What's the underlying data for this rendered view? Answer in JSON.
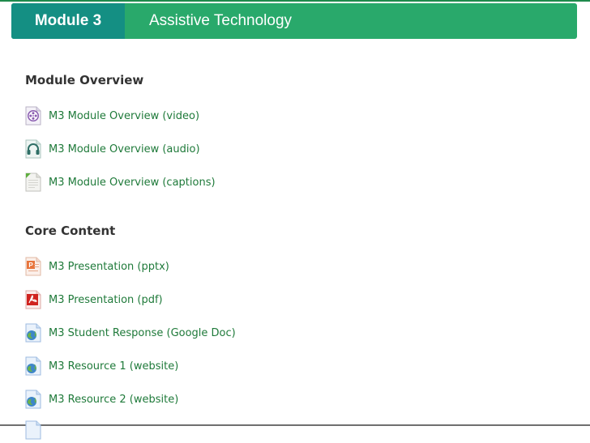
{
  "module": {
    "badge": "Module 3",
    "title": "Assistive Technology"
  },
  "sections": [
    {
      "heading": "Module Overview",
      "items": [
        {
          "label": "M3 Module Overview (video)",
          "icon": "video-file-icon"
        },
        {
          "label": "M3 Module Overview (audio)",
          "icon": "audio-file-icon"
        },
        {
          "label": "M3 Module Overview (captions)",
          "icon": "text-file-icon"
        }
      ]
    },
    {
      "heading": "Core Content",
      "items": [
        {
          "label": "M3 Presentation (pptx)",
          "icon": "powerpoint-file-icon"
        },
        {
          "label": "M3 Presentation (pdf)",
          "icon": "pdf-file-icon"
        },
        {
          "label": "M3 Student Response (Google Doc)",
          "icon": "web-link-icon"
        },
        {
          "label": "M3 Resource 1 (website)",
          "icon": "web-link-icon"
        },
        {
          "label": "M3 Resource 2 (website)",
          "icon": "web-link-icon"
        }
      ]
    }
  ],
  "colors": {
    "header_green": "#29a96b",
    "badge_teal": "#148f83",
    "link_green": "#1f7a3a"
  }
}
